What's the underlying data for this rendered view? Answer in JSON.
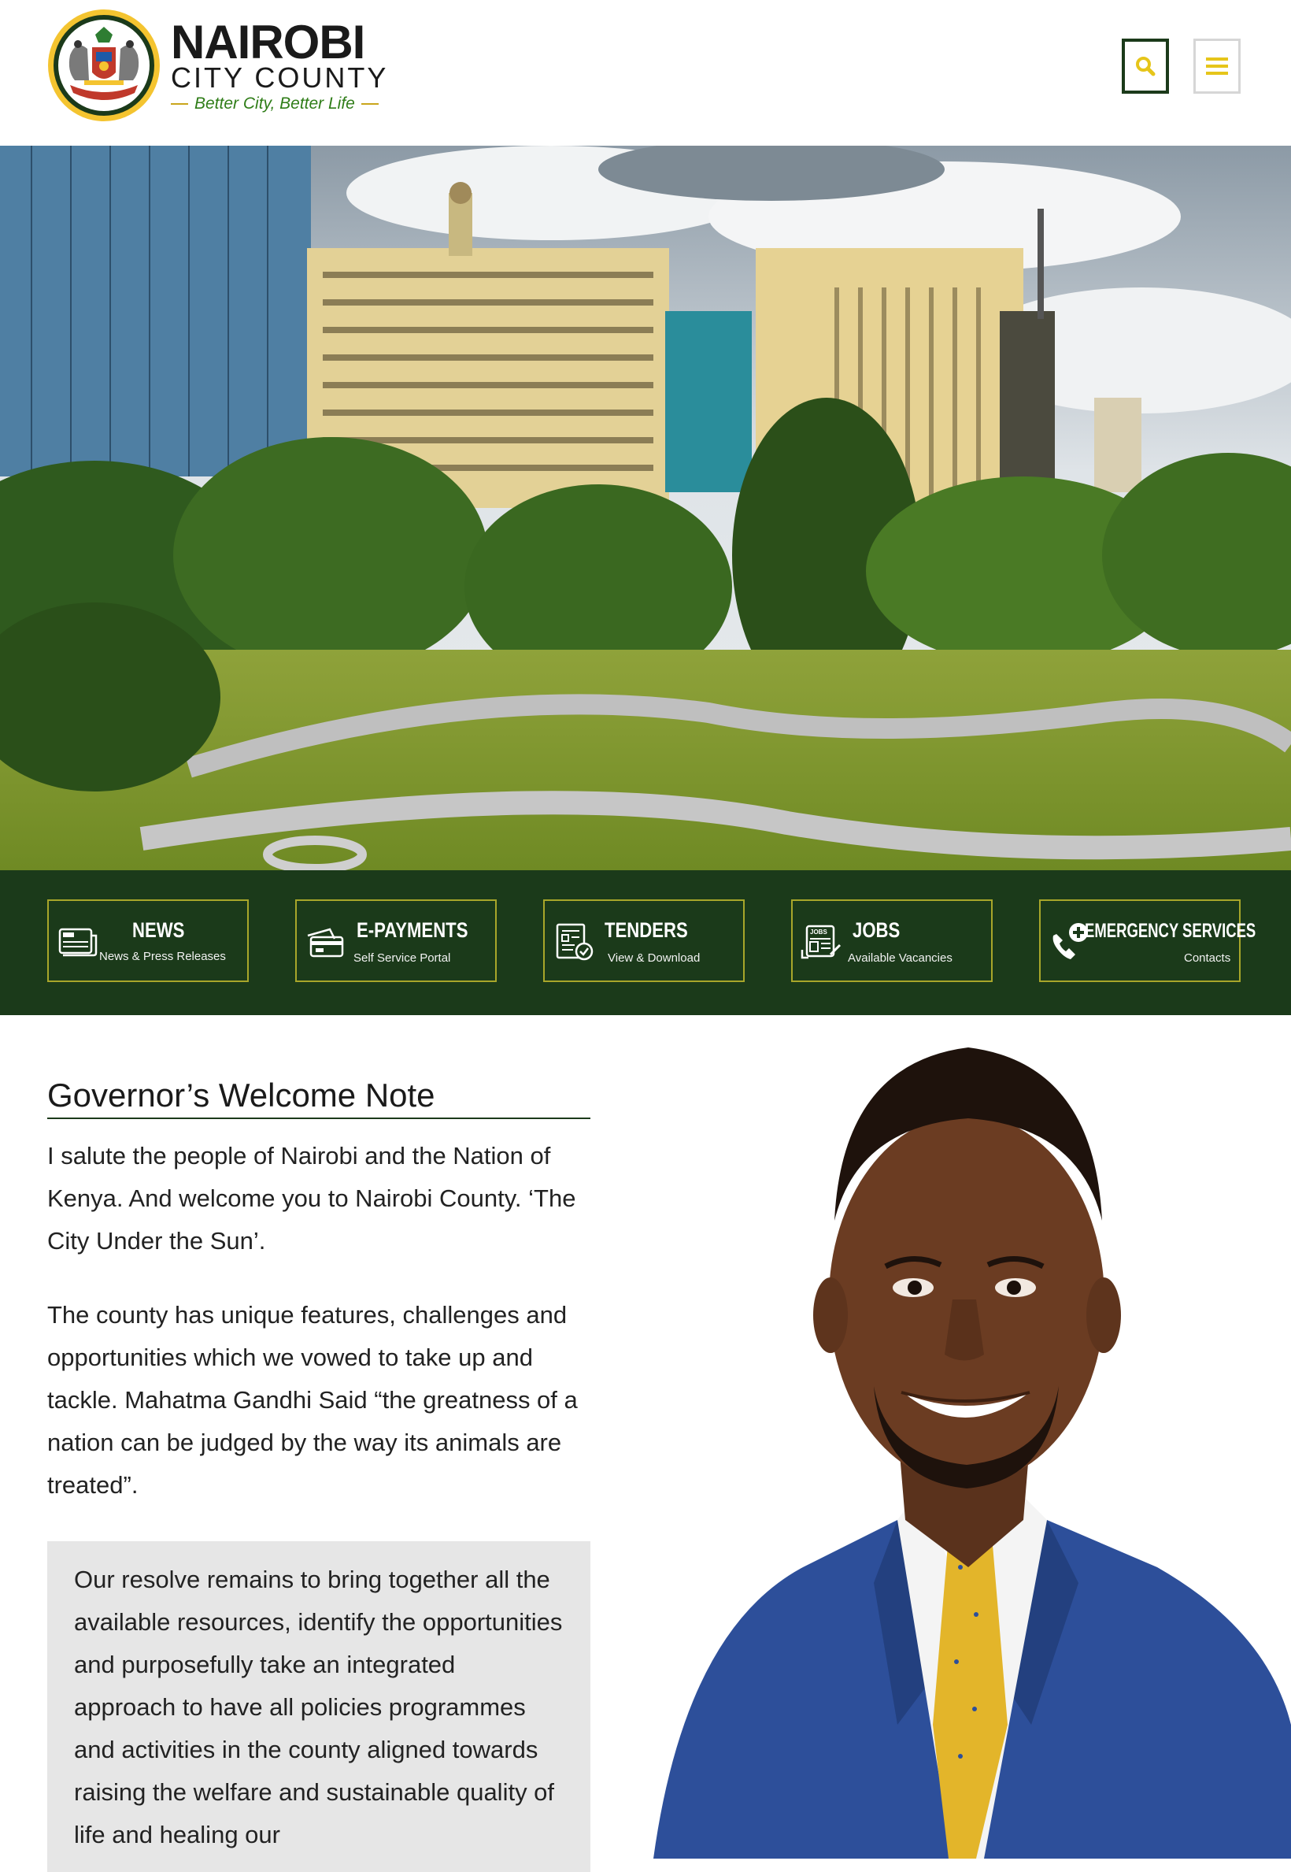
{
  "header": {
    "logo": {
      "line1": "NAIROBI",
      "line2": "CITY COUNTY",
      "tagline": "Better City, Better Life"
    },
    "search_icon": "search-icon",
    "menu_icon": "hamburger-menu-icon"
  },
  "hero": {
    "image": "Nairobi city skyline with trees and park"
  },
  "quick_links": [
    {
      "title": "NEWS",
      "subtitle": "News & Press Releases",
      "icon": "newspaper-icon"
    },
    {
      "title": "E-PAYMENTS",
      "subtitle": "Self Service Portal",
      "icon": "payment-card-icon"
    },
    {
      "title": "TENDERS",
      "subtitle": "View & Download",
      "icon": "document-check-icon"
    },
    {
      "title": "JOBS",
      "subtitle": "Available Vacancies",
      "icon": "jobs-newspaper-icon"
    },
    {
      "title": "EMERGENCY SERVICES",
      "subtitle": "Contacts",
      "icon": "phone-plus-icon"
    }
  ],
  "welcome": {
    "title": "Governor’s Welcome Note",
    "para1": "I salute the people of Nairobi and the Nation of Kenya. And welcome you to Nairobi County. ‘The City Under the Sun’.",
    "para2": "The county has unique features, challenges and opportunities which we vowed to take up and tackle. Mahatma Gandhi Said “the greatness of a nation can be judged by the way its animals are treated”.",
    "quote": "Our resolve remains to bring together all the available resources, identify the opportunities and purposefully take an integrated approach to have all policies programmes and activities in the county aligned towards raising the welfare and sustainable quality of life and healing our"
  },
  "colors": {
    "brand_green": "#1b3a1a",
    "accent_gold": "#e6c51a",
    "card_border": "#a8a62a"
  }
}
